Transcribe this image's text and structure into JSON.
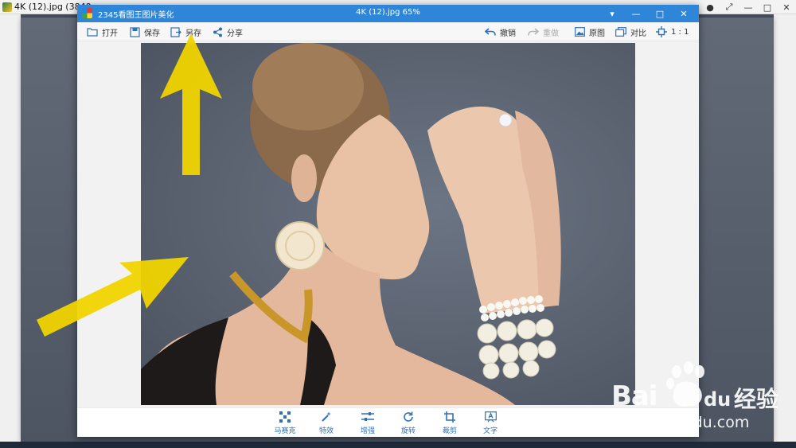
{
  "back_window": {
    "title": "4K (12).jpg  (3840",
    "controls": [
      "●",
      "⤢",
      "—",
      "□",
      "✕"
    ]
  },
  "editor": {
    "app_name": "2345看图王图片美化",
    "doc_title": "4K (12).jpg  65%",
    "window_controls": {
      "menu": "▾",
      "minimize": "—",
      "maximize": "□",
      "close": "✕"
    }
  },
  "toolbar": {
    "open": "打开",
    "save": "保存",
    "save_as": "另存",
    "share": "分享",
    "undo": "撤销",
    "redo": "重做",
    "original": "原图",
    "compare": "对比",
    "actual_size": "1 : 1"
  },
  "bottom_tools": {
    "mosaic": "马赛克",
    "effects": "特效",
    "enhance": "增强",
    "rotate": "旋转",
    "crop": "裁剪",
    "text": "文字"
  },
  "watermark": {
    "brand": "Bai",
    "brand_tail": "du",
    "jingyan": "经验",
    "url": "jingyan.baidu.com"
  },
  "colors": {
    "titlebar": "#2f86d8",
    "icon_blue": "#2f6fb8",
    "arrow_yellow": "#f0d400"
  }
}
